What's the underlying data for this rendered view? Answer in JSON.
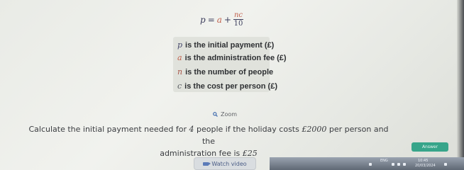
{
  "formula": {
    "lhs": "p",
    "eq": "=",
    "a": "a",
    "plus": "+",
    "numerator": "nc",
    "denominator": "10"
  },
  "definitions": [
    {
      "symbol": "p",
      "text": "is the initial payment (£)"
    },
    {
      "symbol": "a",
      "text": "is the administration fee (£)"
    },
    {
      "symbol": "n",
      "text": "is the number of people"
    },
    {
      "symbol": "c",
      "text": "is the cost per person (£)"
    }
  ],
  "zoom": {
    "label": "Zoom",
    "icon": "search-icon"
  },
  "question": {
    "part1": "Calculate the initial payment needed for",
    "people": "4",
    "part2": "people if the holiday costs",
    "cost": "£2000",
    "part3": "per person and the",
    "part4": "administration fee is",
    "fee": "£25"
  },
  "buttons": {
    "answer": "Answer",
    "watch_video": "Watch video"
  },
  "taskbar": {
    "lang": "ENG",
    "time": "10:45",
    "date": "20/03/2024"
  }
}
